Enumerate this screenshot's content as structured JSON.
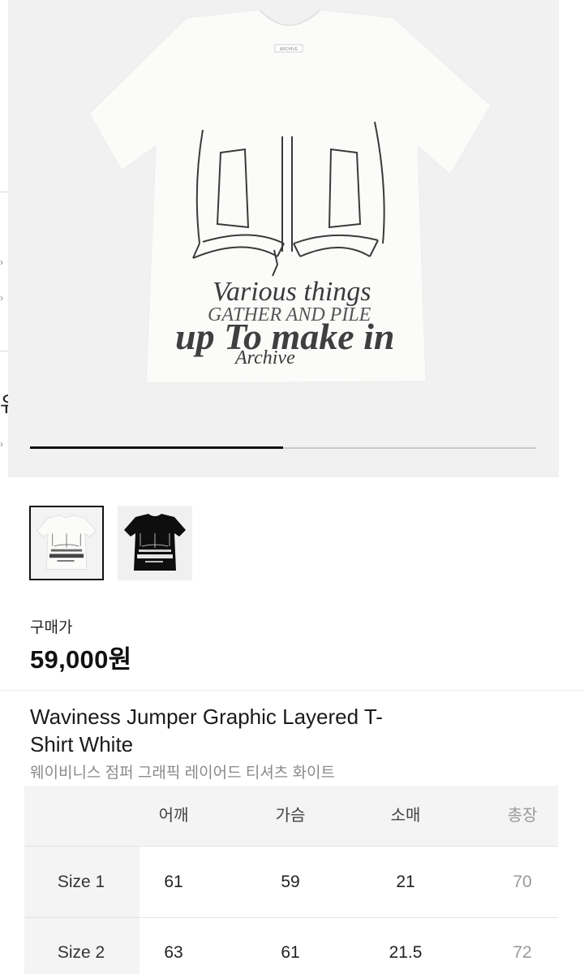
{
  "gallery": {
    "shirt_print_text": [
      "Various things",
      "GATHER AND PILE",
      "up To make in",
      "Archive"
    ],
    "neck_label": "ARCHIVE",
    "progress_fraction": 0.5,
    "left_edge_glyph": "유",
    "thumbnails": [
      {
        "name": "thumbnail-white",
        "color": "white",
        "selected": true
      },
      {
        "name": "thumbnail-black",
        "color": "black",
        "selected": false
      }
    ]
  },
  "price": {
    "label": "구매가",
    "value": "59,000원"
  },
  "product": {
    "title_en_line1": "Waviness Jumper Graphic Layered T-",
    "title_en_line2": "Shirt White",
    "title_ko": "웨이비니스 점퍼 그래픽 레이어드 티셔츠 화이트"
  },
  "size_table": {
    "headers": [
      "어깨",
      "가슴",
      "소매",
      "총장"
    ],
    "rows": [
      {
        "label": "Size 1",
        "values": [
          "61",
          "59",
          "21",
          "70"
        ]
      },
      {
        "label": "Size 2",
        "values": [
          "63",
          "61",
          "21.5",
          "72"
        ]
      }
    ]
  },
  "colors": {
    "background": "#ffffff",
    "image_bg": "#f1f1f1",
    "text": "#111111",
    "muted": "#8a8a8a",
    "progress_track": "#c9c9c9",
    "progress_fill": "#111111"
  }
}
